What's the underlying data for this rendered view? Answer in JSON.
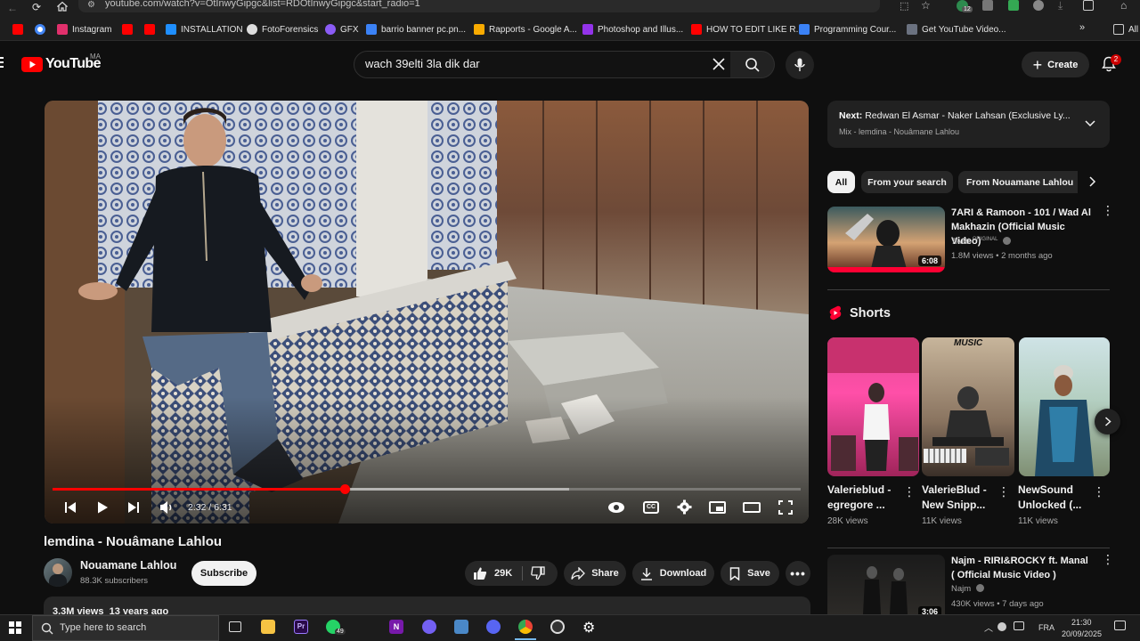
{
  "browser": {
    "url": "youtube.com/watch?v=OtInwyGipgc&list=RDOtInwyGipgc&start_radio=1",
    "extension_badge": "12",
    "bookmarks": [
      {
        "label": "",
        "color": "#ff0000"
      },
      {
        "label": "",
        "color": "#4285f4"
      },
      {
        "label": "Instagram",
        "color": "#e1306c"
      },
      {
        "label": "",
        "color": "#ff0000"
      },
      {
        "label": "",
        "color": "#ff0000"
      },
      {
        "label": "INSTALLATION",
        "color": "#1f8fff"
      },
      {
        "label": "FotoForensics",
        "color": "#dddddd"
      },
      {
        "label": "GFX",
        "color": "#8b5cf6"
      },
      {
        "label": "barrio banner pc.pn...",
        "color": "#3b82f6"
      },
      {
        "label": "Rapports - Google A...",
        "color": "#f9ab00"
      },
      {
        "label": "Photoshop and Illus...",
        "color": "#9333ea"
      },
      {
        "label": "HOW TO EDIT LIKE R...",
        "color": "#ff0000"
      },
      {
        "label": "Programming Cour...",
        "color": "#3b82f6"
      },
      {
        "label": "Get YouTube Video...",
        "color": "#6b7280"
      }
    ],
    "all_bookmarks_label": "All"
  },
  "youtube": {
    "logo_text": "YouTube",
    "country_code": "MA",
    "search_value": "wach 39elti 3la dik dar",
    "create_label": "Create",
    "notification_count": "2"
  },
  "player": {
    "time_current": "2:32",
    "time_total": "6:31",
    "progress": 0.39,
    "buffered": 0.69
  },
  "video": {
    "title": "lemdina - Nouâmane Lahlou",
    "channel": "Nouamane Lahlou",
    "subscribers": "88.3K subscribers",
    "subscribe_label": "Subscribe",
    "likes": "29K",
    "share_label": "Share",
    "download_label": "Download",
    "save_label": "Save",
    "stats": "3.3M views  13 years ago"
  },
  "sidebar": {
    "next_prefix": "Next:",
    "next_title": "Redwan El Asmar - Naker Lahsan (Exclusive Ly...",
    "mix_label": "Mix - lemdina - Nouâmane Lahlou",
    "chips": [
      "All",
      "From your search",
      "From Nouamane Lahlou"
    ],
    "videos": [
      {
        "title": "7ARI & Ramoon - 101 / Wad Al Makhazin (Official Music Video)",
        "channel": "7ARI",
        "channel_tag": "ORIGINAL",
        "meta": "1.8M views • 2 months ago",
        "duration": "6:08"
      },
      {
        "title": "Najm - RIRI&ROCKY ft. Manal ( Official Music Video )",
        "channel": "Najm",
        "meta": "430K views • 7 days ago",
        "duration": "3:06"
      }
    ],
    "shorts_heading": "Shorts",
    "shorts": [
      {
        "title": "Valerieblud - egregore ...",
        "views": "28K views"
      },
      {
        "title": "ValerieBlud - New Snipp...",
        "views": "11K views"
      },
      {
        "title": "NewSound Unlocked (...",
        "views": "11K views"
      }
    ],
    "short2_overlay": "MUSIC"
  },
  "taskbar": {
    "search_placeholder": "Type here to search",
    "whatsapp_badge": "49",
    "language": "FRA",
    "time": "21:30",
    "date": "20/09/2025"
  }
}
